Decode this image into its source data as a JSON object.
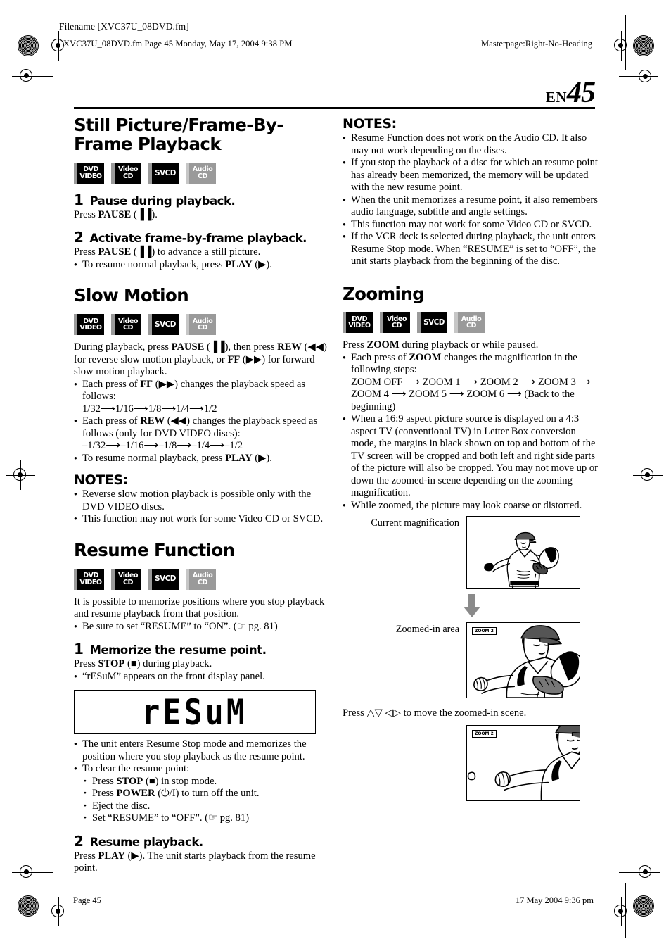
{
  "header": {
    "filename_label": "Filename [XVC37U_08DVD.fm]",
    "fm_line": "XVC37U_08DVD.fm  Page 45  Monday, May 17, 2004  9:38 PM",
    "masterpage": "Masterpage:Right-No-Heading",
    "lang_code": "EN",
    "page_number": "45"
  },
  "footer": {
    "page_label": "Page 45",
    "timestamp": "17 May 2004 9:36 pm"
  },
  "badge_labels": {
    "dvd_line1": "DVD",
    "dvd_line2": "VIDEO",
    "videocd_line1": "Video",
    "videocd_line2": "CD",
    "svcd": "SVCD",
    "audiocd_line1": "Audio",
    "audiocd_line2": "CD"
  },
  "left_column": {
    "still_picture": {
      "heading": "Still Picture/Frame-By-Frame Playback",
      "step1": {
        "number": "1",
        "title": "Pause during playback.",
        "body_pre": "Press ",
        "body_bold": "PAUSE",
        "body_post": " (▐▐)."
      },
      "step2": {
        "number": "2",
        "title": "Activate frame-by-frame playback.",
        "body_pre": "Press ",
        "body_bold": "PAUSE",
        "body_post": " (▐▐) to advance a still picture.",
        "bullet_pre": "To resume normal playback, press ",
        "bullet_bold": "PLAY",
        "bullet_post": " (▶)."
      }
    },
    "slow_motion": {
      "heading": "Slow Motion",
      "intro_a": "During playback, press ",
      "intro_pause": "PAUSE",
      "intro_b": " (▐▐), then press ",
      "intro_rew": "REW",
      "intro_c": " (◀◀) for reverse slow motion playback, or ",
      "intro_ff": "FF",
      "intro_d": " (▶▶) for forward slow motion playback.",
      "bullets": [
        {
          "pre": "Each press of ",
          "bold": "FF",
          "post": " (▶▶) changes the playback speed as follows:",
          "sub": "1/32⟶1/16⟶1/8⟶1/4⟶1/2"
        },
        {
          "pre": "Each press of ",
          "bold": "REW",
          "post": " (◀◀) changes the playback speed as follows (only for DVD VIDEO discs):",
          "sub": "–1/32⟶–1/16⟶–1/8⟶–1/4⟶–1/2"
        },
        {
          "pre": "To resume normal playback, press ",
          "bold": "PLAY",
          "post": " (▶).",
          "sub": ""
        }
      ],
      "notes_heading": "NOTES:",
      "notes": [
        "Reverse slow motion playback is possible only with the DVD VIDEO discs.",
        "This function may not work for some Video CD or SVCD."
      ]
    },
    "resume_function": {
      "heading": "Resume Function",
      "intro": "It is possible to memorize positions where you stop playback and resume playback from that position.",
      "intro_bullet": "Be sure to set “RESUME” to “ON”. (☞ pg. 81)",
      "step1": {
        "number": "1",
        "title": "Memorize the resume point.",
        "body_pre": "Press ",
        "body_bold": "STOP",
        "body_post": " (■) during playback.",
        "bullet": "“rESuM” appears on the front display panel."
      },
      "display_text": "rESuM",
      "after_display": [
        "The unit enters Resume Stop mode and memorizes the position where you stop playback as the resume point.",
        "To clear the resume point:"
      ],
      "clear_items": [
        {
          "pre": "Press ",
          "bold": "STOP",
          "post": " (■) in stop mode."
        },
        {
          "pre": "Press ",
          "bold": "POWER",
          "post": " (⏻/I) to turn off the unit."
        },
        {
          "pre": "Eject the disc.",
          "bold": "",
          "post": ""
        },
        {
          "pre": "Set “RESUME” to “OFF”. (☞ pg. 81)",
          "bold": "",
          "post": ""
        }
      ],
      "step2": {
        "number": "2",
        "title": "Resume playback.",
        "body_pre": "Press ",
        "body_bold": "PLAY",
        "body_post": " (▶). The unit starts playback from the resume point."
      }
    }
  },
  "right_column": {
    "notes": {
      "heading": "NOTES:",
      "items": [
        "Resume Function does not work on the Audio CD. It also may not work depending on the discs.",
        "If you stop the playback of a disc for which an resume point has already been memorized, the memory will be updated with the new resume point.",
        "When the unit memorizes a resume point, it also remembers audio language, subtitle and angle settings.",
        "This function may not work for some Video CD or SVCD.",
        "If the VCR deck is selected during playback, the unit enters Resume Stop mode. When “RESUME” is set to “OFF”, the unit starts playback from the beginning of the disc."
      ]
    },
    "zooming": {
      "heading": "Zooming",
      "intro_pre": "Press ",
      "intro_bold": "ZOOM",
      "intro_post": " during playback or while paused.",
      "bullet1_pre": "Each press of ",
      "bullet1_bold": "ZOOM",
      "bullet1_post": " changes the magnification in the following steps:",
      "zoom_steps_line1": "ZOOM OFF ⟶ ZOOM 1 ⟶ ZOOM 2 ⟶ ZOOM 3⟶",
      "zoom_steps_line2": "ZOOM 4 ⟶ ZOOM 5 ⟶ ZOOM 6 ⟶ (Back to the beginning)",
      "bullet2": "When a 16:9 aspect picture source is displayed on a 4:3 aspect TV (conventional TV) in Letter Box conversion mode, the margins in black shown on top and bottom of the TV screen will be cropped and both left and right side parts of the picture will also be cropped. You may not move up or down the zoomed-in scene depending on the zooming magnification.",
      "bullet3": "While zoomed, the picture may look coarse or distorted.",
      "caption_current": "Current magnification",
      "caption_zoomed": "Zoomed-in area",
      "zoom_tag": "ZOOM 2",
      "press_move": "Press △▽ ◁▷ to move the zoomed-in scene."
    }
  }
}
